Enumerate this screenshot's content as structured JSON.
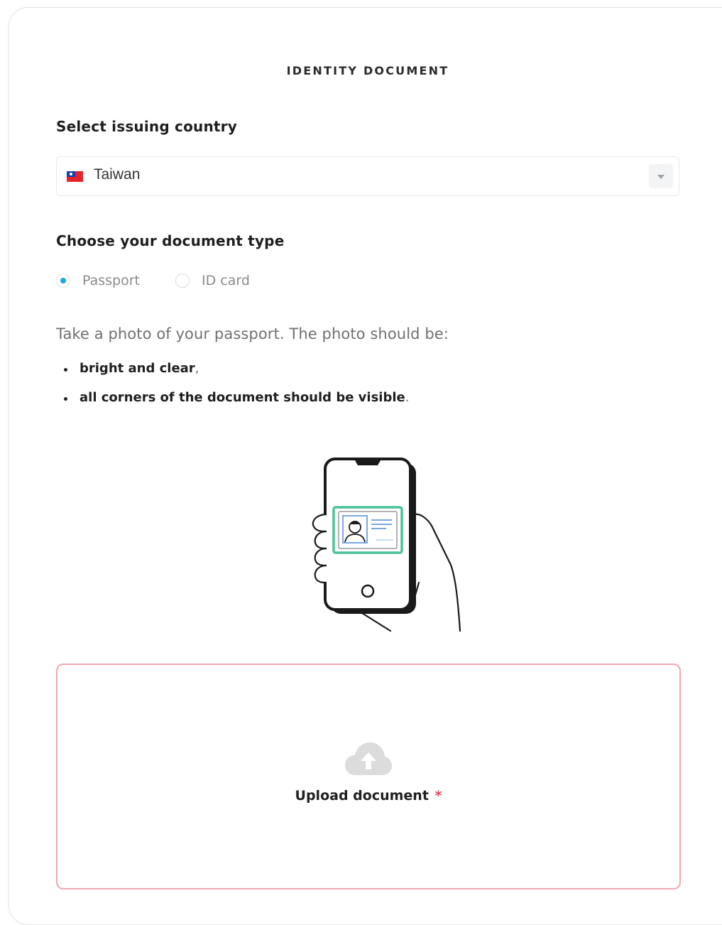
{
  "section": {
    "title": "IDENTITY DOCUMENT"
  },
  "country": {
    "label": "Select issuing country",
    "selected": "Taiwan",
    "flag_icon": "taiwan-flag-icon"
  },
  "document_type": {
    "label": "Choose your document type",
    "options": [
      {
        "label": "Passport",
        "checked": true
      },
      {
        "label": "ID card",
        "checked": false
      }
    ]
  },
  "instructions": {
    "intro": "Take a photo of your passport. The photo should be:",
    "bullets": [
      {
        "text": "bright and clear",
        "trail": ","
      },
      {
        "text": "all corners of the document should be visible",
        "trail": "."
      }
    ]
  },
  "upload": {
    "label": "Upload document",
    "required_marker": "*",
    "icon": "cloud-upload-icon"
  },
  "colors": {
    "accent": "#1ba8df",
    "upload_border": "#f0a7b2",
    "required": "#e0485a",
    "document_frame": "#4cc29a",
    "document_blue": "#7aa7e0"
  }
}
